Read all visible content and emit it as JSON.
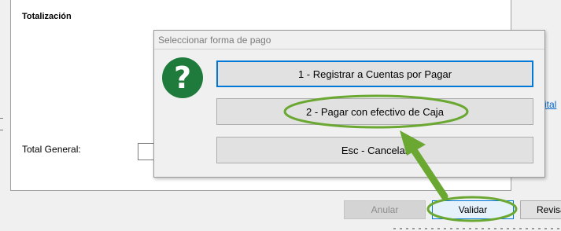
{
  "panel": {
    "title": "Totalización",
    "total_label": "Total General:",
    "right_link_fragment": "ital"
  },
  "dialog": {
    "title": "Seleccionar forma de pago",
    "options": [
      "1 - Registrar a Cuentas por Pagar",
      "2 - Pagar con efectivo de Caja",
      "Esc - Cancelar"
    ]
  },
  "buttons": {
    "anular": "Anular",
    "validar": "Validar",
    "revisar": "Revisar"
  },
  "colors": {
    "annotation": "#6aa832",
    "icon_green": "#1e7b3c",
    "focus_blue": "#0078d7"
  },
  "icons": {
    "question": "question-icon"
  },
  "glyphs": {
    "question": "?"
  }
}
